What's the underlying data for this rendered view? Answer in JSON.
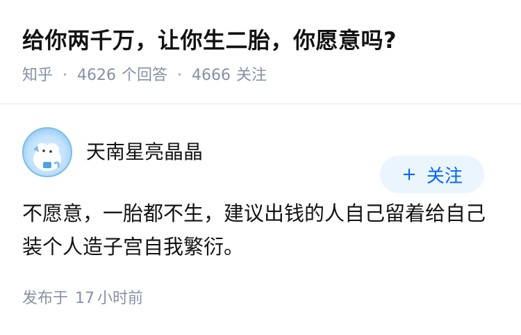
{
  "question": {
    "title": "给你两千万，让你生二胎，你愿意吗?",
    "source": "知乎",
    "answer_count": "4626",
    "answer_label": "个回答",
    "follower_count": "4666",
    "follower_label": "关注"
  },
  "answer": {
    "author_name": "天南星亮晶晶",
    "follow_label": "关注",
    "follow_icon": "plus-icon",
    "body": "不愿意，一胎都不生，建议出钱的人自己留着给自己装个人造子宫自我繁衍。",
    "posted_prefix": "发布于",
    "posted_number": "17",
    "posted_unit": "小时前"
  },
  "colors": {
    "text": "#121212",
    "meta": "#8590a6",
    "accent": "#0066ff",
    "button_bg": "#ebf5fd"
  }
}
